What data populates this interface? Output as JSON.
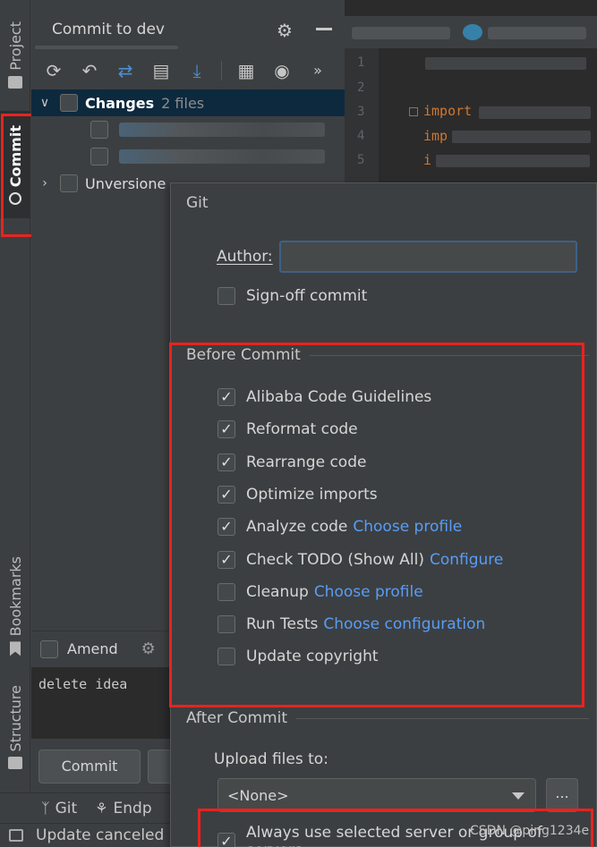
{
  "left_strip": {
    "project_label": "Project",
    "commit_label": "Commit",
    "bookmarks_label": "Bookmarks",
    "structure_label": "Structure"
  },
  "commit_panel": {
    "title": "Commit to dev",
    "changes_label": "Changes",
    "changes_count": "2 files",
    "unversioned_label": "Unversione",
    "amend_label": "Amend",
    "message": "delete idea",
    "commit_button": "Commit"
  },
  "editor": {
    "line_numbers": [
      "1",
      "2",
      "3",
      "4",
      "5"
    ],
    "line3_code": "import",
    "line4_code": "imp",
    "line5_code": "i"
  },
  "bottom_toolbar": {
    "git_label": "Git",
    "endpoints_label": "Endp"
  },
  "status_bar": {
    "text": "Update canceled ("
  },
  "popup": {
    "git_section": "Git",
    "author_label": "Author:",
    "author_value": "",
    "signoff_label": "Sign-off commit",
    "before_commit_section": "Before Commit",
    "before_commit_options": [
      {
        "label": "Alibaba Code Guidelines",
        "checked": true,
        "link": ""
      },
      {
        "label": "Reformat code",
        "checked": true,
        "link": ""
      },
      {
        "label": "Rearrange code",
        "checked": true,
        "link": ""
      },
      {
        "label": "Optimize imports",
        "checked": true,
        "link": ""
      },
      {
        "label": "Analyze code",
        "checked": true,
        "link": "Choose profile"
      },
      {
        "label": "Check TODO (Show All)",
        "checked": true,
        "link": "Configure"
      },
      {
        "label": "Cleanup",
        "checked": false,
        "link": "Choose profile"
      },
      {
        "label": "Run Tests",
        "checked": false,
        "link": "Choose configuration"
      },
      {
        "label": "Update copyright",
        "checked": false,
        "link": ""
      }
    ],
    "after_commit_section": "After Commit",
    "upload_label": "Upload files to:",
    "upload_selected": "<None>",
    "browse_label": "...",
    "always_use_label": "Always use selected server or group of servers"
  },
  "watermark": "CSDN @ping1234e",
  "colors": {
    "highlight_border": "#e8231f",
    "link": "#589df6",
    "selection": "#0d293e",
    "panel_bg": "#3c3f41"
  }
}
